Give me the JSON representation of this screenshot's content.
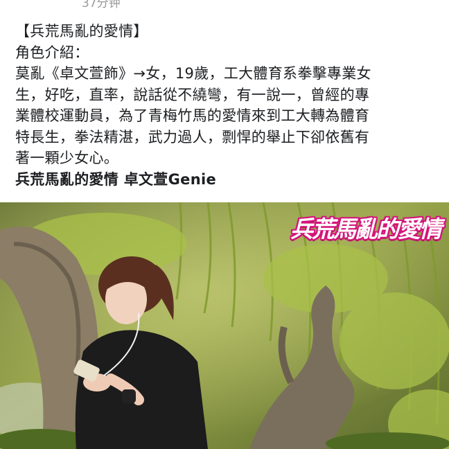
{
  "post": {
    "timestamp": "37分钟",
    "text_lines": [
      "【兵荒馬亂的愛情】",
      "角色介紹：",
      "莫亂《卓文萱飾》→女，19歲，工大體育系拳擊專業女",
      "生，好吃，直率，說話從不繞彎，有一說一，曾經的專",
      "業體校運動員，為了青梅竹馬的愛情來到工大轉為體育",
      "特長生，拳法精湛，武力過人，剽悍的舉止下卻依舊有",
      "著一顆少女心。"
    ],
    "hashtag_line": "兵荒馬亂的愛情 卓文萱Genie"
  },
  "photo": {
    "logo_text": "兵荒馬亂的愛情",
    "description_icon": "drama-still-photo"
  },
  "colors": {
    "logo_pink": "#d4157a",
    "text": "#1c1e21",
    "timestamp": "#9a9a9a"
  }
}
